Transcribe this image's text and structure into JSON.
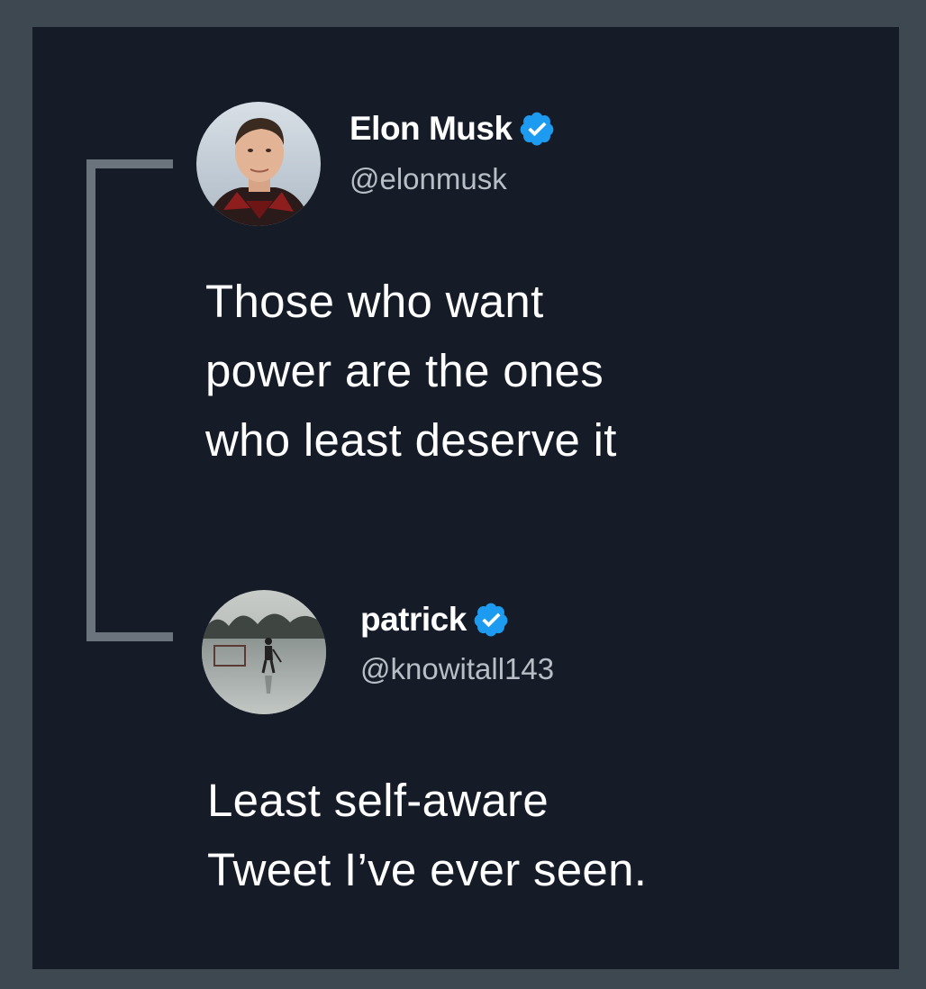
{
  "tweets": [
    {
      "author": "Elon Musk",
      "handle": "@elonmusk",
      "verified": true,
      "avatar_icon": "elon-musk-avatar",
      "text": "Those who want\npower are the ones\nwho least deserve it"
    },
    {
      "author": "patrick",
      "handle": "@knowitall143",
      "verified": true,
      "avatar_icon": "ice-skater-avatar",
      "text": "Least self-aware\nTweet I’ve ever seen."
    }
  ],
  "colors": {
    "outer_frame": "#3e4850",
    "card_background": "#151c28",
    "connector_line": "#6b737c",
    "verified_badge": "#1d9bf0",
    "name_text": "#ffffff",
    "handle_text": "#b9bec6",
    "tweet_text": "#ffffff"
  }
}
